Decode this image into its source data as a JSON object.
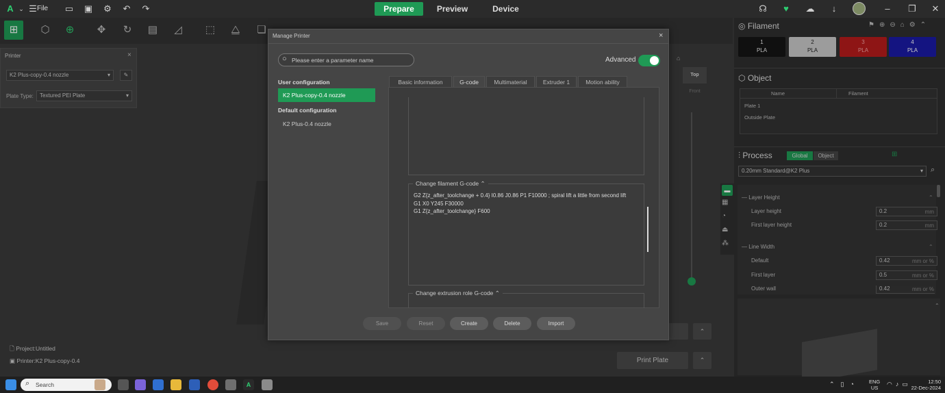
{
  "titlebar": {
    "menu_label": "File",
    "tabs": [
      "Prepare",
      "Preview",
      "Device"
    ],
    "active_tab": "Prepare",
    "accent": "#1f9a55"
  },
  "printer_panel": {
    "title": "Printer",
    "printer_value": "K2 Plus-copy-0.4 nozzle",
    "plate_label": "Plate Type:",
    "plate_value": "Textured PEI Plate"
  },
  "viewport": {
    "top_label": "Top",
    "front_label": "Front"
  },
  "project": {
    "project_label": "Project:Untitled",
    "printer_label": "Printer:K2 Plus-copy-0.4"
  },
  "print_plate": "Print Plate",
  "right": {
    "filament_title": "Filament",
    "filaments": [
      {
        "num": "1",
        "type": "PLA",
        "color": "#151515",
        "text": "#eeeeee"
      },
      {
        "num": "2",
        "type": "PLA",
        "color": "#c8c8c8",
        "text": "#222222"
      },
      {
        "num": "3",
        "type": "PLA",
        "color": "#b71c1c",
        "text": "#f2a0a0"
      },
      {
        "num": "4",
        "type": "PLA",
        "color": "#1a1aa6",
        "text": "#ffffff"
      }
    ],
    "object_title": "Object",
    "object_headers": [
      "Name",
      "Filament"
    ],
    "objects": [
      "Plate 1",
      "Outside Plate"
    ],
    "process_title": "Process",
    "process_tabs": [
      "Global",
      "Object"
    ],
    "process_profile": "0.20mm Standard@K2 Plus",
    "layer_height_group": "Layer Height",
    "layer_height_label": "Layer height",
    "layer_height_value": "0.2",
    "first_layer_height_label": "First layer height",
    "first_layer_height_value": "0.2",
    "line_width_group": "Line Width",
    "default_label": "Default",
    "default_value": "0.42",
    "first_layer_label": "First layer",
    "first_layer_value": "0.5",
    "outer_wall_label": "Outer wall",
    "outer_wall_value": "0.42",
    "unit_mm": "mm",
    "unit_mm_pct": "mm or %"
  },
  "dialog": {
    "title": "Manage Printer",
    "search_placeholder": "Please enter a parameter name",
    "advanced_label": "Advanced",
    "user_config_title": "User configuration",
    "user_config_item": "K2 Plus-copy-0.4 nozzle",
    "default_config_title": "Default configuration",
    "default_config_item": "K2 Plus-0.4 nozzle",
    "tabs": [
      "Basic information",
      "G-code",
      "Multimaterial",
      "Extruder 1",
      "Motion ability"
    ],
    "active_tab": "G-code",
    "change_filament_label": "Change filament G-code",
    "gcode_lines": [
      "G2 Z{z_after_toolchange + 0.4} I0.86 J0.86 P1 F10000 ; spiral lift a little from second lift",
      "G1 X0 Y245 F30000",
      "G1 Z{z_after_toolchange} F600"
    ],
    "extrusion_role_label": "Change extrusion role G-code",
    "buttons": [
      "Save",
      "Reset",
      "Create",
      "Delete",
      "Import"
    ]
  },
  "taskbar": {
    "search_placeholder": "Search",
    "lang": "ENG",
    "region": "US",
    "time": "12:50",
    "date": "22-Dec-2024"
  }
}
